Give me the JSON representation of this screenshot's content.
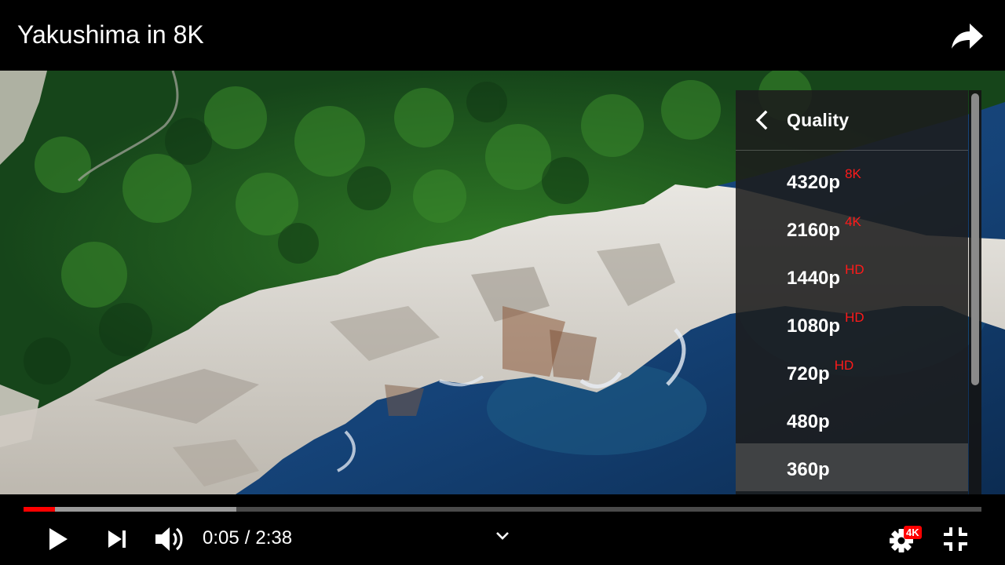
{
  "header": {
    "title": "Yakushima in 8K",
    "share_icon": "share-arrow-icon"
  },
  "quality_menu": {
    "title": "Quality",
    "back_icon": "chevron-left-icon",
    "items": [
      {
        "label": "4320p",
        "badge": "8K",
        "selected": false
      },
      {
        "label": "2160p",
        "badge": "4K",
        "selected": false
      },
      {
        "label": "1440p",
        "badge": "HD",
        "selected": false
      },
      {
        "label": "1080p",
        "badge": "HD",
        "selected": false
      },
      {
        "label": "720p",
        "badge": "HD",
        "selected": false
      },
      {
        "label": "480p",
        "badge": "",
        "selected": false
      },
      {
        "label": "360p",
        "badge": "",
        "selected": true
      }
    ],
    "badge_color": "#ff1a1a"
  },
  "controls": {
    "current_time": "0:05",
    "separator": "/",
    "duration": "2:38",
    "played_fraction": 0.033,
    "buffered_fraction": 0.222,
    "settings_badge": "4K",
    "icons": [
      "play-icon",
      "next-icon",
      "volume-icon",
      "chevron-down-icon",
      "settings-gear-icon",
      "exit-fullscreen-icon"
    ]
  },
  "colors": {
    "accent": "#ff0000",
    "background": "#000000"
  }
}
